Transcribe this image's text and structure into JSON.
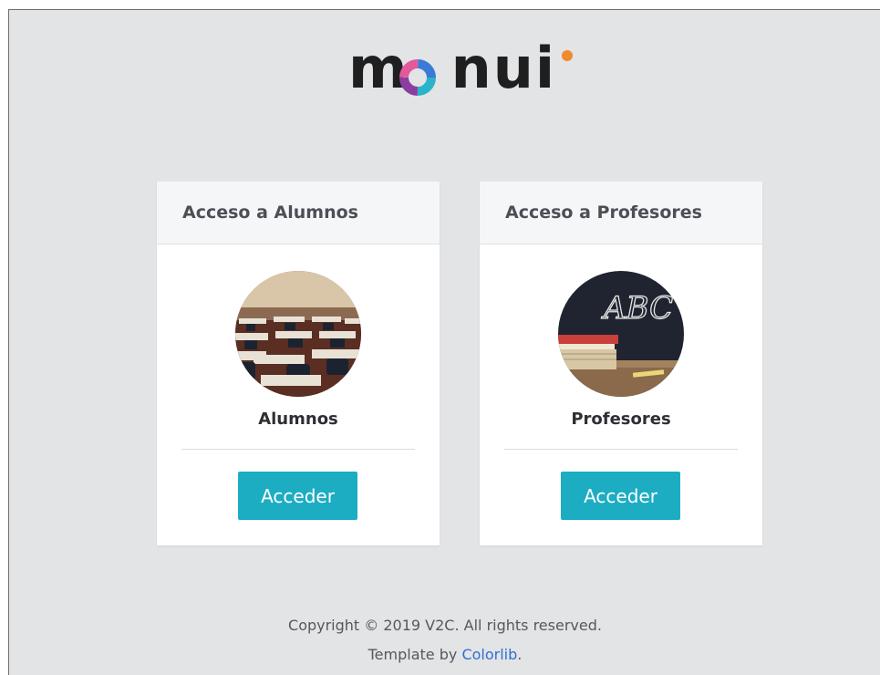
{
  "brand": {
    "logo_text_before": "m",
    "logo_text_after": "nui",
    "colors": {
      "o_segments": [
        "#2bb4c9",
        "#8a3fa0",
        "#e35a9a",
        "#3a7bd5"
      ],
      "dot": "#f08a2c"
    }
  },
  "cards": [
    {
      "title": "Acceso a Alumnos",
      "image_icon": "classroom-photo",
      "label": "Alumnos",
      "button_label": "Acceder"
    },
    {
      "title": "Acceso a Profesores",
      "image_icon": "chalkboard-abc-photo",
      "image_text": "ABC",
      "label": "Profesores",
      "button_label": "Acceder"
    }
  ],
  "footer": {
    "copyright": "Copyright © 2019 V2C. All rights reserved.",
    "template_prefix": "Template by ",
    "template_link": "Colorlib",
    "template_suffix": "."
  },
  "colors": {
    "accent": "#1cadc2",
    "link": "#2f6fcf",
    "background": "#e2e4e6"
  }
}
